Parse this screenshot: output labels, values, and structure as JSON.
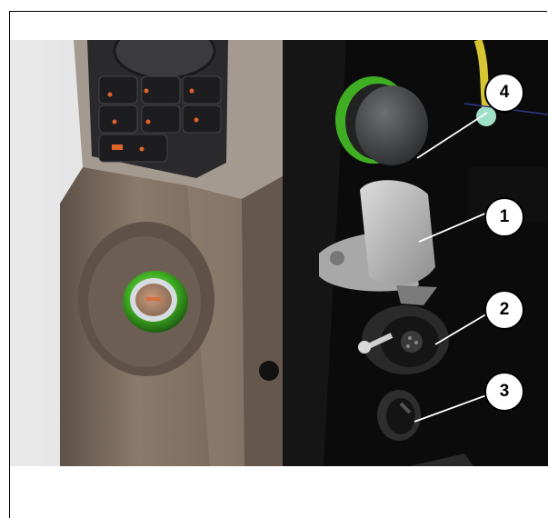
{
  "figure": {
    "description_icons": [
      "photo-of-control-panel"
    ],
    "callouts": [
      {
        "id": "callout-4",
        "label": "4"
      },
      {
        "id": "callout-1",
        "label": "1"
      },
      {
        "id": "callout-2",
        "label": "2"
      },
      {
        "id": "callout-3",
        "label": "3"
      }
    ]
  },
  "colors": {
    "panel_black": "#0a0a0a",
    "housing_taupe": "#7c6c5e",
    "backlight_orange": "#e0632b",
    "ring_green": "#49c22b",
    "cable_yellow": "#d8c532"
  }
}
